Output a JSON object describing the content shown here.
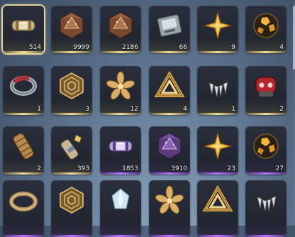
{
  "inventory": {
    "rows": [
      [
        {
          "icon": "capsule-canister-icon",
          "count": "514",
          "rarity": "gold",
          "selected": true
        },
        {
          "icon": "bronze-d20-die-icon",
          "count": "9999",
          "rarity": "gold"
        },
        {
          "icon": "bronze-d20-die-icon",
          "count": "2186",
          "rarity": "gold"
        },
        {
          "icon": "metal-chip-device-icon",
          "count": "66",
          "rarity": "gold"
        },
        {
          "icon": "gold-star-shard-icon",
          "count": "9",
          "rarity": "gold"
        },
        {
          "icon": "amber-sphere-orb-icon",
          "count": "4",
          "rarity": "gold"
        }
      ],
      [
        {
          "icon": "red-ring-band-icon",
          "count": "1",
          "rarity": "gold"
        },
        {
          "icon": "gold-spiral-hexagon-icon",
          "count": "3",
          "rarity": "gold"
        },
        {
          "icon": "gold-flower-emblem-icon",
          "count": "12",
          "rarity": "gold"
        },
        {
          "icon": "gold-triangle-knot-icon",
          "count": "4",
          "rarity": "gold"
        },
        {
          "icon": "silver-claw-necklace-icon",
          "count": "1",
          "rarity": "gold"
        },
        {
          "icon": "red-gauntlet-mask-icon",
          "count": "2",
          "rarity": "gold"
        }
      ],
      [
        {
          "icon": "bronze-scroll-cylinder-icon",
          "count": "2",
          "rarity": "gold"
        },
        {
          "icon": "broken-relic-piece-icon",
          "count": "393",
          "rarity": "gold"
        },
        {
          "icon": "purple-capsule-canister-icon",
          "count": "1853",
          "rarity": "purple"
        },
        {
          "icon": "purple-d20-die-icon",
          "count": "3910",
          "rarity": "purple"
        },
        {
          "icon": "gold-star-shard-icon",
          "count": "23",
          "rarity": "purple"
        },
        {
          "icon": "amber-sphere-orb-icon",
          "count": "27",
          "rarity": "purple"
        }
      ],
      [
        {
          "icon": "bronze-ring-band-icon",
          "count": "",
          "rarity": "purple"
        },
        {
          "icon": "gold-spiral-hexagon-icon",
          "count": "",
          "rarity": "purple"
        },
        {
          "icon": "crystal-flower-icon",
          "count": "",
          "rarity": "purple"
        },
        {
          "icon": "gold-flower-emblem-icon",
          "count": "",
          "rarity": "purple"
        },
        {
          "icon": "gold-triangle-knot-icon",
          "count": "",
          "rarity": "purple"
        },
        {
          "icon": "silver-claw-necklace-icon",
          "count": "",
          "rarity": "purple"
        }
      ]
    ]
  }
}
